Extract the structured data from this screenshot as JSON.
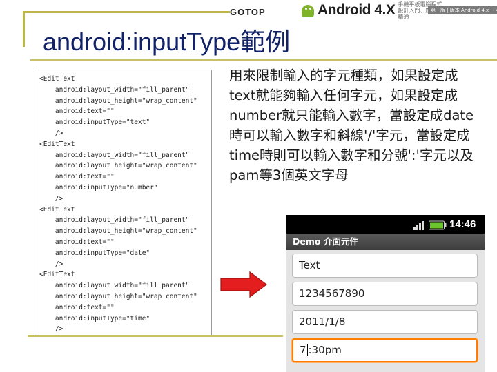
{
  "header": {
    "publisher": "GOTOP",
    "brand": "Android 4.X",
    "brand_sub": "手機平板電腦程式設計入門、應用到精通",
    "tab_text": "第一版 | 版本 Android 4.x ~ 4.X"
  },
  "slide": {
    "title": "android:inputType範例",
    "code_lines": [
      "<EditText",
      "    android:layout_width=\"fill_parent\"",
      "    android:layout_height=\"wrap_content\"",
      "    android:text=\"\"",
      "    android:inputType=\"text\"",
      "    />",
      "<EditText",
      "    android:layout_width=\"fill_parent\"",
      "    android:layout_height=\"wrap_content\"",
      "    android:text=\"\"",
      "    android:inputType=\"number\"",
      "    />",
      "<EditText",
      "    android:layout_width=\"fill_parent\"",
      "    android:layout_height=\"wrap_content\"",
      "    android:text=\"\"",
      "    android:inputType=\"date\"",
      "    />",
      "<EditText",
      "    android:layout_width=\"fill_parent\"",
      "    android:layout_height=\"wrap_content\"",
      "    android:text=\"\"",
      "    android:inputType=\"time\"",
      "    />"
    ],
    "description": "用來限制輸入的字元種類，如果設定成text就能夠輸入任何字元，如果設定成number就只能輸入數字，當設定成date時可以輸入數字和斜線'/'字元，當設定成time時則可以輸入數字和分號':'字元以及pam等3個英文字母"
  },
  "phone": {
    "time": "14:46",
    "app_title": "Demo 介面元件",
    "fields": {
      "text": "Text",
      "number": "1234567890",
      "date": "2011/1/8",
      "time_before_caret": "7",
      "time_after_caret": ":30pm"
    }
  },
  "colors": {
    "title": "#112266",
    "arrow": "#e41e1e",
    "focus": "#ff7d00",
    "frame": "#bfb44a"
  }
}
